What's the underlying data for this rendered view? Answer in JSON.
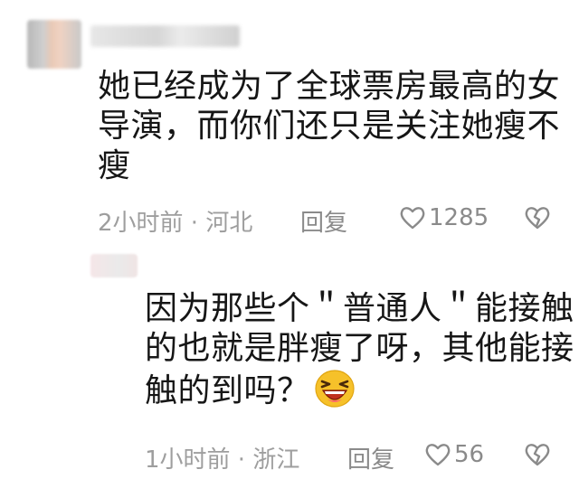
{
  "comments": [
    {
      "text_lines": [
        "她已经成为了全球票房最高的女",
        "导演，而你们还只是关注她瘦不",
        "瘦"
      ],
      "time_location": "2小时前 · 河北",
      "reply_label": "回复",
      "likes": "1285"
    },
    {
      "text_lines": [
        "因为那些个＂普通人＂能接触",
        "的也就是胖瘦了呀，其他能接",
        "触的到吗？"
      ],
      "time_location": "1小时前 · 浙江",
      "reply_label": "回复",
      "likes": "56"
    }
  ],
  "icons": {
    "like": "heart-outline-icon",
    "dislike": "broken-heart-icon",
    "emoji": "laughing-emoji-icon"
  },
  "colors": {
    "text": "#161616",
    "meta": "#9e9e9e",
    "icon": "#8a8a8a"
  }
}
